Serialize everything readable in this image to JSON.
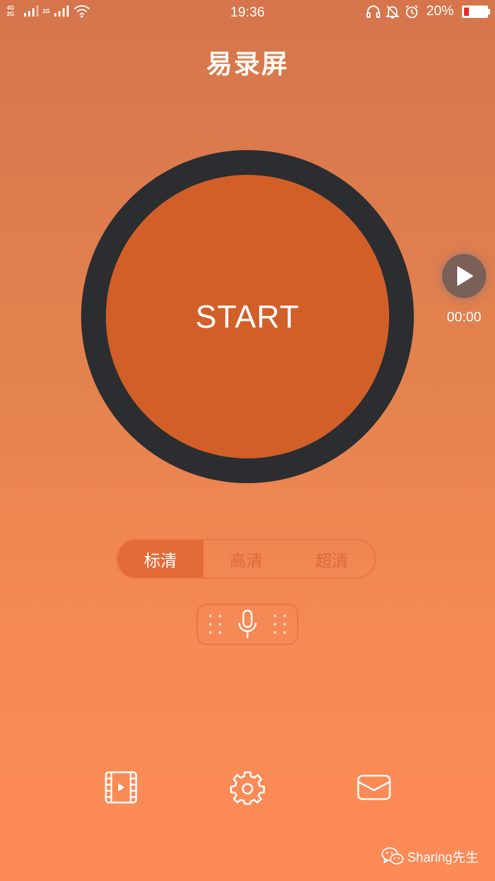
{
  "status_bar": {
    "network1_label_top": "4G",
    "network1_label_bottom": "2G",
    "network2_label": "2G",
    "time": "19:36",
    "battery_percent_text": "20%",
    "battery_level": 0.2,
    "battery_color": "#e8282b",
    "icons": [
      "signal-icon",
      "wifi-icon",
      "headset-icon",
      "mute-bell-icon",
      "alarm-icon",
      "battery-icon"
    ]
  },
  "app": {
    "title": "易录屏"
  },
  "record": {
    "start_label": "START",
    "playback_time": "00:00"
  },
  "quality": {
    "options": [
      "标清",
      "高清",
      "超清"
    ],
    "selected": "标清"
  },
  "bottom_nav": {
    "icons": [
      "video-library-icon",
      "settings-icon",
      "mail-icon"
    ]
  },
  "watermark": {
    "text": "Sharing先生",
    "icon": "wechat-icon"
  },
  "colors": {
    "background_top": "#d6754c",
    "background_bottom": "#fd8a57",
    "ring": "#2b2d31",
    "start_fill": "#d35f28",
    "accent": "#e36b38"
  }
}
